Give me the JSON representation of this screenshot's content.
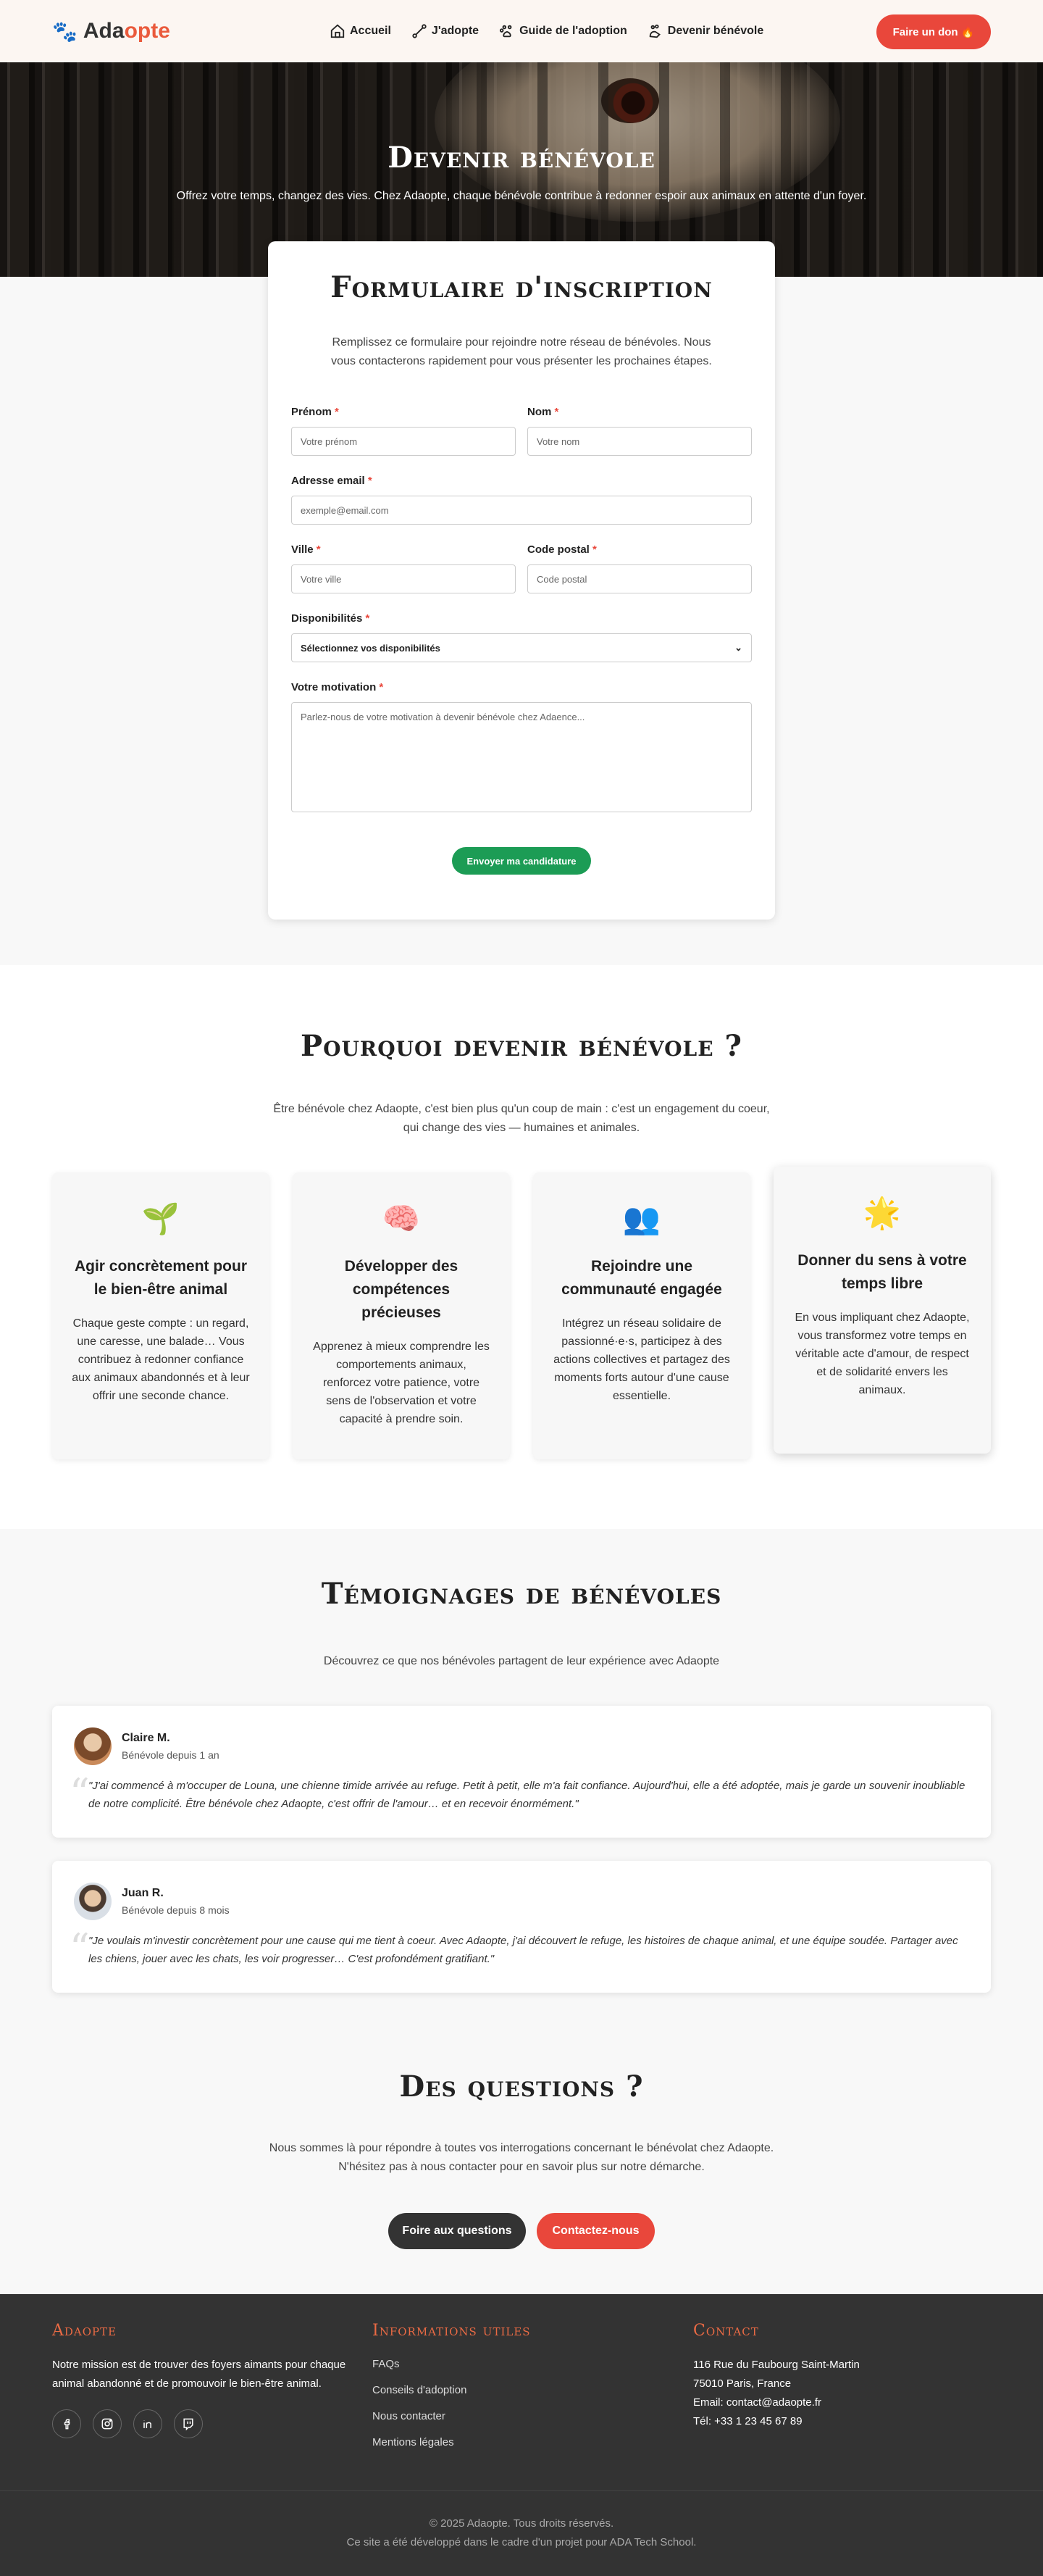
{
  "header": {
    "logo_part1": "Ada",
    "logo_part2": "opte",
    "nav": [
      {
        "label": "Accueil",
        "icon": "home-icon"
      },
      {
        "label": "J'adopte",
        "icon": "bone-icon"
      },
      {
        "label": "Guide de l'adoption",
        "icon": "paw-book-icon"
      },
      {
        "label": "Devenir bénévole",
        "icon": "hand-heart-icon"
      }
    ],
    "donate_label": "Faire un don 🔥"
  },
  "hero": {
    "title": "Devenir bénévole",
    "subtitle": "Offrez votre temps, changez des vies. Chez Adaopte, chaque bénévole contribue à redonner espoir aux animaux en attente d'un foyer."
  },
  "form": {
    "title": "Formulaire d'inscription",
    "intro": "Remplissez ce formulaire pour rejoindre notre réseau de bénévoles. Nous vous contacterons rapidement pour vous présenter les prochaines étapes.",
    "firstname": {
      "label": "Prénom",
      "placeholder": "Votre prénom"
    },
    "lastname": {
      "label": "Nom",
      "placeholder": "Votre nom"
    },
    "email": {
      "label": "Adresse email",
      "placeholder": "exemple@email.com"
    },
    "city": {
      "label": "Ville",
      "placeholder": "Votre ville"
    },
    "postal": {
      "label": "Code postal",
      "placeholder": "Code postal"
    },
    "availability": {
      "label": "Disponibilités",
      "value": "Sélectionnez vos disponibilités"
    },
    "motivation": {
      "label": "Votre motivation",
      "placeholder": "Parlez-nous de votre motivation à devenir bénévole chez Adaence..."
    },
    "required_mark": "*",
    "submit_label": "Envoyer ma candidature"
  },
  "why": {
    "title": "Pourquoi devenir bénévole ?",
    "subtitle_line1": "Être bénévole chez Adaopte, c'est bien plus qu'un coup de main : c'est un engagement du coeur,",
    "subtitle_line2": "qui change des vies — humaines et animales.",
    "cards": [
      {
        "emoji": "🌱",
        "title": "Agir concrètement pour le bien-être animal",
        "text": "Chaque geste compte : un regard, une caresse, une balade… Vous contribuez à redonner confiance aux animaux abandonnés et à leur offrir une seconde chance."
      },
      {
        "emoji": "🧠",
        "title": "Développer des compétences précieuses",
        "text": "Apprenez à mieux comprendre les comportements animaux, renforcez votre patience, votre sens de l'observation et votre capacité à prendre soin."
      },
      {
        "emoji": "👥",
        "title": "Rejoindre une communauté engagée",
        "text": "Intégrez un réseau solidaire de passionné·e·s, participez à des actions collectives et partagez des moments forts autour d'une cause essentielle."
      },
      {
        "emoji": "🌟",
        "title": "Donner du sens à votre temps libre",
        "text": "En vous impliquant chez Adaopte, vous transformez votre temps en véritable acte d'amour, de respect et de solidarité envers les animaux."
      }
    ]
  },
  "testimonials": {
    "title": "Témoignages de bénévoles",
    "subtitle": "Découvrez ce que nos bénévoles partagent de leur expérience avec Adaopte",
    "items": [
      {
        "name": "Claire M.",
        "since": "Bénévole depuis 1 an",
        "quote": "\"J'ai commencé à m'occuper de Louna, une chienne timide arrivée au refuge. Petit à petit, elle m'a fait confiance. Aujourd'hui, elle a été adoptée, mais je garde un souvenir inoubliable de notre complicité. Être bénévole chez Adaopte, c'est offrir de l'amour… et en recevoir énormément.\""
      },
      {
        "name": "Juan R.",
        "since": "Bénévole depuis 8 mois",
        "quote": "\"Je voulais m'investir concrètement pour une cause qui me tient à coeur. Avec Adaopte, j'ai découvert le refuge, les histoires de chaque animal, et une équipe soudée. Partager avec les chiens, jouer avec les chats, les voir progresser… C'est profondément gratifiant.\""
      }
    ]
  },
  "questions": {
    "title": "Des questions ?",
    "line1": "Nous sommes là pour répondre à toutes vos interrogations concernant le bénévolat chez Adaopte.",
    "line2": "N'hésitez pas à nous contacter pour en savoir plus sur notre démarche.",
    "faq_label": "Foire aux questions",
    "contact_label": "Contactez-nous"
  },
  "footer": {
    "col1_title": "Adaopte",
    "mission": "Notre mission est de trouver des foyers aimants pour chaque animal abandonné et de promouvoir le bien-être animal.",
    "socials": [
      "facebook-icon",
      "instagram-icon",
      "linkedin-icon",
      "twitch-icon"
    ],
    "col2_title": "Informations utiles",
    "links": [
      "FAQs",
      "Conseils d'adoption",
      "Nous contacter",
      "Mentions légales"
    ],
    "col3_title": "Contact",
    "address1": "116 Rue du Faubourg Saint-Martin",
    "address2": "75010 Paris, France",
    "email": "Email: contact@adaopte.fr",
    "phone": "Tél: +33 1 23 45 67 89",
    "copyright": "© 2025 Adaopte. Tous droits réservés.",
    "credit": "Ce site a été développé dans le cadre d'un projet pour ADA Tech School."
  }
}
